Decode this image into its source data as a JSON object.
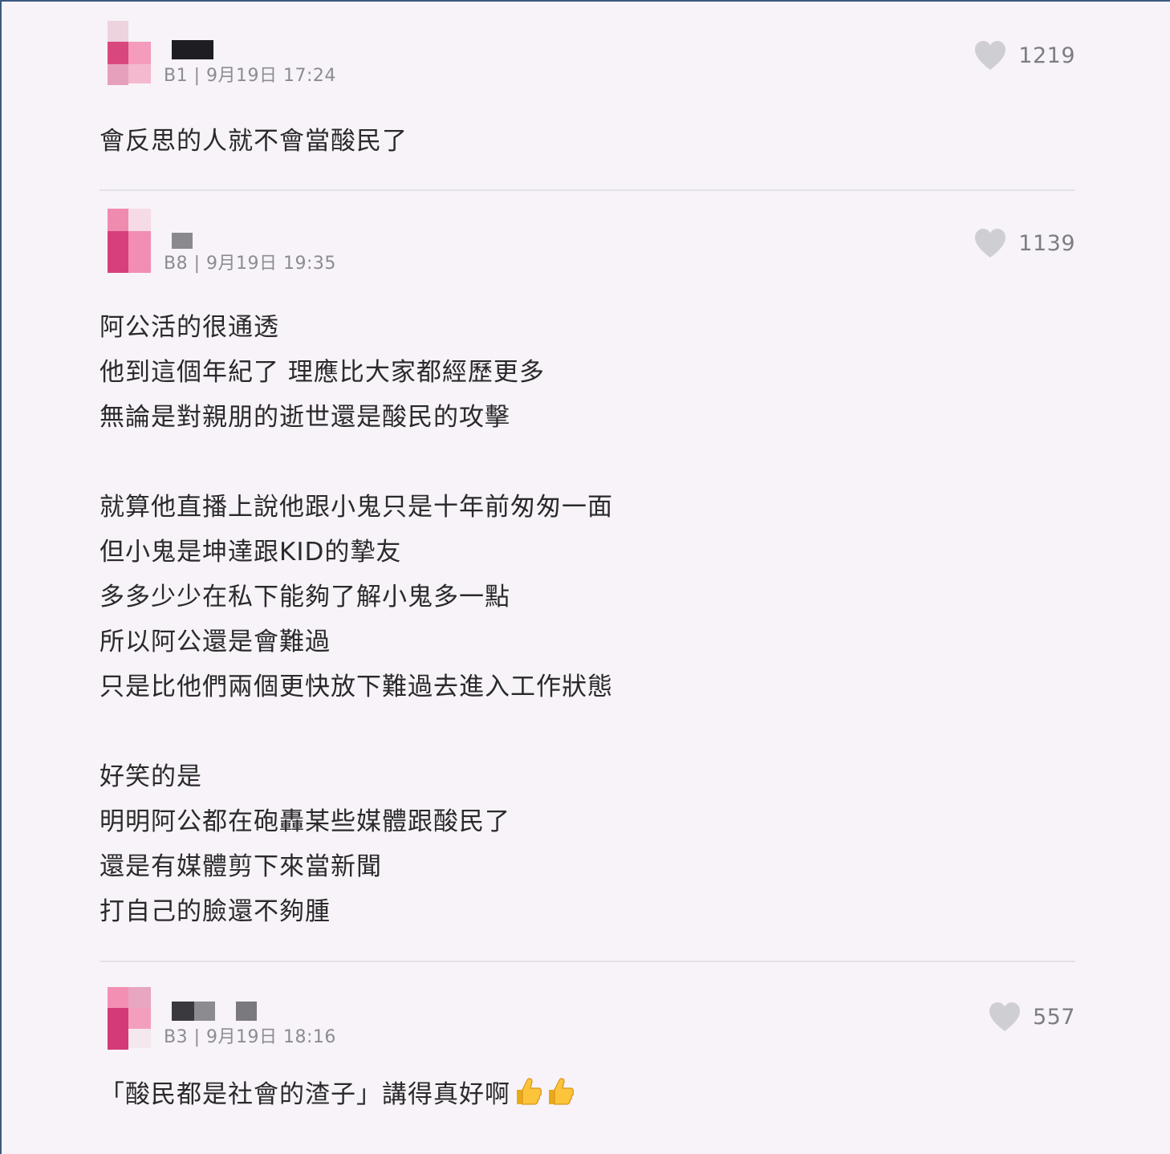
{
  "comments": [
    {
      "meta": "B1 | 9月19日 17:24",
      "likes": "1219",
      "lines": [
        "會反思的人就不會當酸民了"
      ]
    },
    {
      "meta": "B8 | 9月19日 19:35",
      "likes": "1139",
      "lines": [
        "阿公活的很通透",
        "他到這個年紀了 理應比大家都經歷更多",
        "無論是對親朋的逝世還是酸民的攻擊",
        "",
        "就算他直播上說他跟小鬼只是十年前匆匆一面",
        "但小鬼是坤達跟KID的摯友",
        "多多少少在私下能夠了解小鬼多一點",
        "所以阿公還是會難過",
        "只是比他們兩個更快放下難過去進入工作狀態",
        "",
        "好笑的是",
        "明明阿公都在砲轟某些媒體跟酸民了",
        "還是有媒體剪下來當新聞",
        "打自己的臉還不夠腫"
      ]
    },
    {
      "meta": "B3 | 9月19日 18:16",
      "likes": "557",
      "lines": [
        "「酸民都是社會的渣子」講得真好啊"
      ],
      "emoji": [
        "thumbs-up-icon",
        "thumbs-up-icon"
      ]
    }
  ],
  "colors": {
    "background": "#f7f3f9",
    "heart": "#cfcfd3",
    "meta_text": "#8c8c90",
    "avatar_pink": "#e04b86"
  }
}
